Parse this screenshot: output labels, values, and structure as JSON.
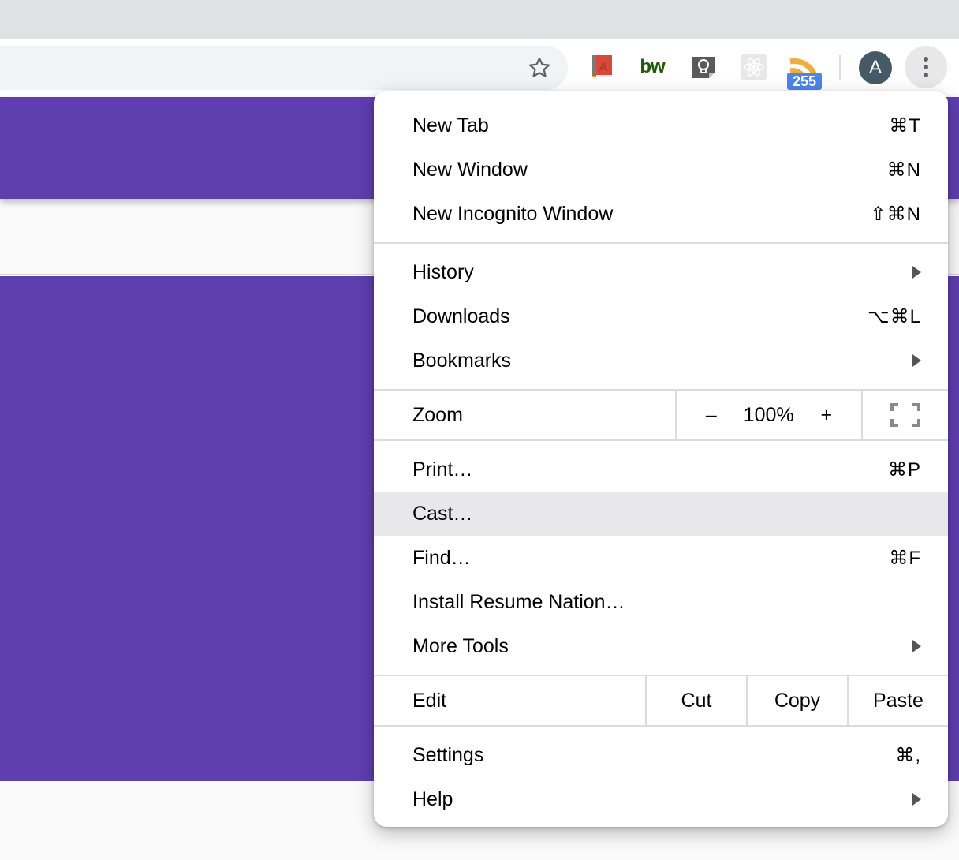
{
  "toolbar": {
    "bookmark_icon": "star-outline-icon",
    "extensions": [
      {
        "name": "dictionary-extension",
        "icon": "red-book-A-icon"
      },
      {
        "name": "bw-extension",
        "icon": "bw-logo-icon",
        "text": "bw"
      },
      {
        "name": "keep-extension",
        "icon": "lightbulb-icon"
      },
      {
        "name": "react-devtools-extension",
        "icon": "react-atom-icon"
      },
      {
        "name": "rss-extension",
        "icon": "rss-feed-icon",
        "badge": "255"
      }
    ],
    "avatar_initial": "A",
    "menu_icon": "three-dots-vertical-icon"
  },
  "colors": {
    "brand_purple": "#5f3eaf",
    "badge_blue": "#4a86e8",
    "avatar_bg": "#455a64",
    "rss_orange": "#f0ad3d",
    "bw_green": "#1f5a0c",
    "highlight": "#e8e8eb"
  },
  "menu": {
    "group1": [
      {
        "label": "New Tab",
        "shortcut": "⌘T"
      },
      {
        "label": "New Window",
        "shortcut": "⌘N"
      },
      {
        "label": "New Incognito Window",
        "shortcut": "⇧⌘N"
      }
    ],
    "group2": [
      {
        "label": "History",
        "submenu": true
      },
      {
        "label": "Downloads",
        "shortcut": "⌥⌘L"
      },
      {
        "label": "Bookmarks",
        "submenu": true
      }
    ],
    "zoom": {
      "label": "Zoom",
      "minus": "–",
      "value": "100%",
      "plus": "+",
      "fullscreen_icon": "fullscreen-icon"
    },
    "group3": [
      {
        "label": "Print…",
        "shortcut": "⌘P"
      },
      {
        "label": "Cast…",
        "highlighted": true
      },
      {
        "label": "Find…",
        "shortcut": "⌘F"
      },
      {
        "label": "Install Resume Nation…"
      },
      {
        "label": "More Tools",
        "submenu": true
      }
    ],
    "edit": {
      "label": "Edit",
      "cut": "Cut",
      "copy": "Copy",
      "paste": "Paste"
    },
    "group4": [
      {
        "label": "Settings",
        "shortcut": "⌘,"
      },
      {
        "label": "Help",
        "submenu": true
      }
    ]
  }
}
